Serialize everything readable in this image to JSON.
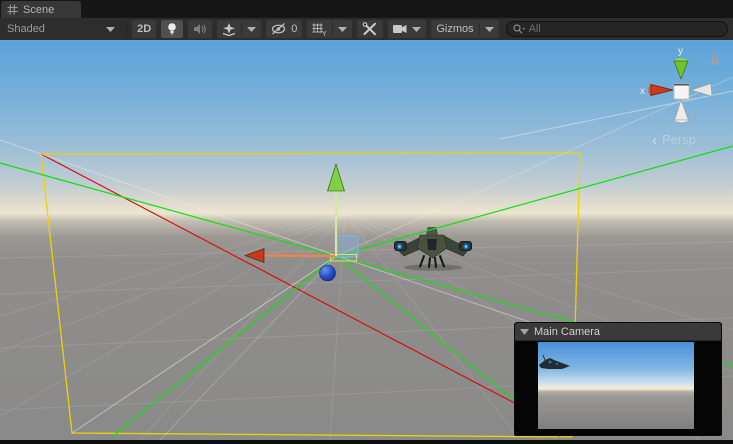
{
  "tab": {
    "label": "Scene"
  },
  "toolbar": {
    "shading_dropdown": "Shaded",
    "toggle_2d": "2D",
    "visibility_count": "0",
    "gizmos_button": "Gizmos",
    "search": {
      "placeholder": "All"
    }
  },
  "viewport": {
    "orientation_gizmo": {
      "y_label": "y",
      "x_label": "x",
      "projection_label": "Persp",
      "back_arrow": "‹"
    },
    "camera_preview": {
      "title": "Main Camera"
    }
  },
  "colors": {
    "focus_accent": "#5fa3d8",
    "frustum_yellow": "#f0d202",
    "wire_green": "#0fe00f",
    "wire_red": "#dd0500",
    "axis_x_red": "#c63a17",
    "axis_y_green": "#7fd23e",
    "axis_z_blue": "#2a4fd0",
    "sky_top": "#5ca3da",
    "ground_gray": "#8a8a8a"
  }
}
